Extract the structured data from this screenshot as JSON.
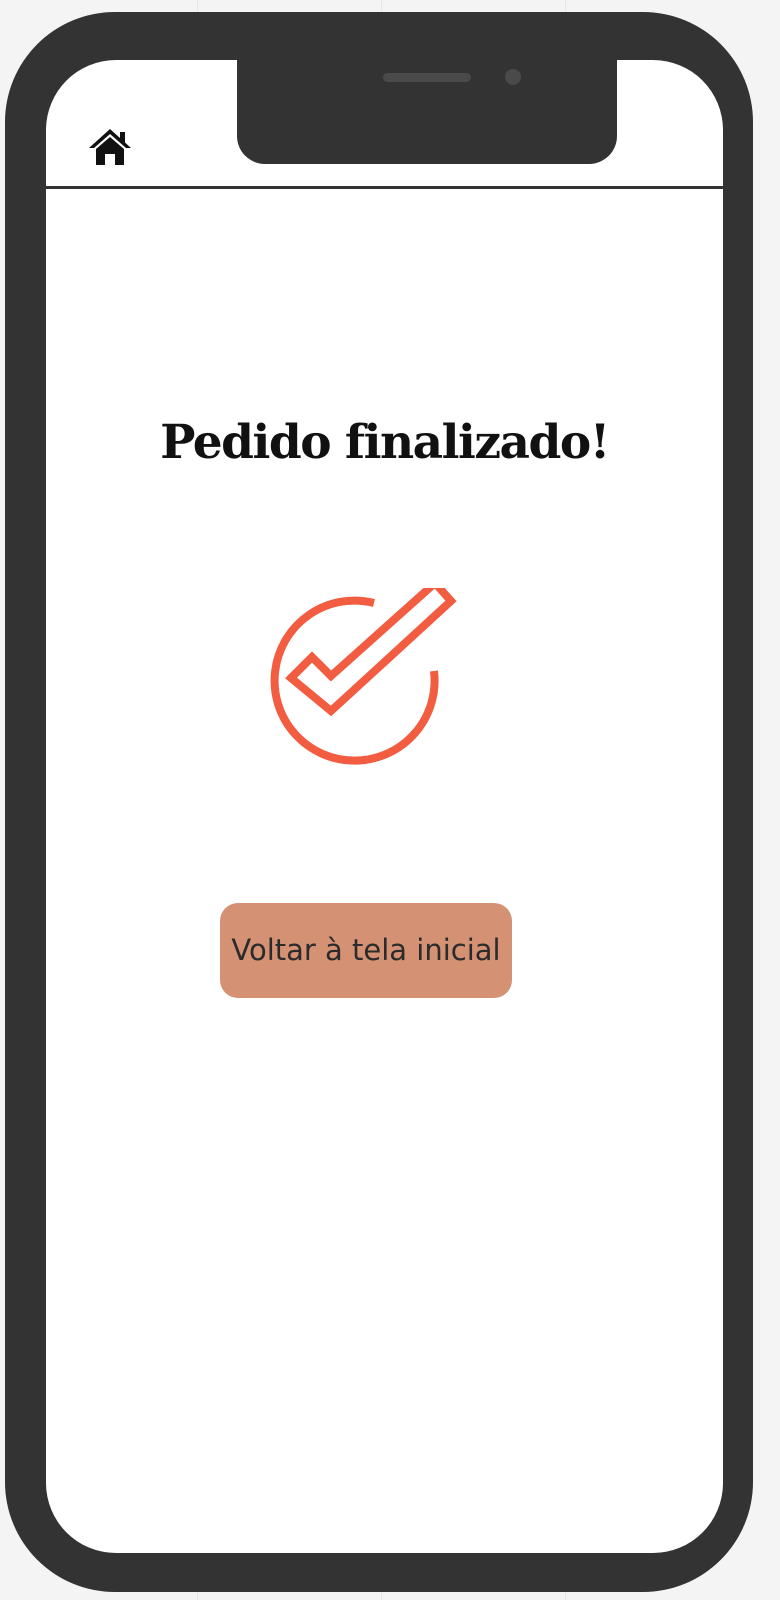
{
  "header": {
    "home_icon": "home-icon"
  },
  "main": {
    "title": "Pedido finalizado!",
    "status_icon": "check-circle-icon",
    "back_button_label": "Voltar à tela inicial"
  },
  "colors": {
    "frame": "#333333",
    "accent": "#f25c40",
    "button_bg": "#d49174",
    "title_text": "#111111"
  }
}
